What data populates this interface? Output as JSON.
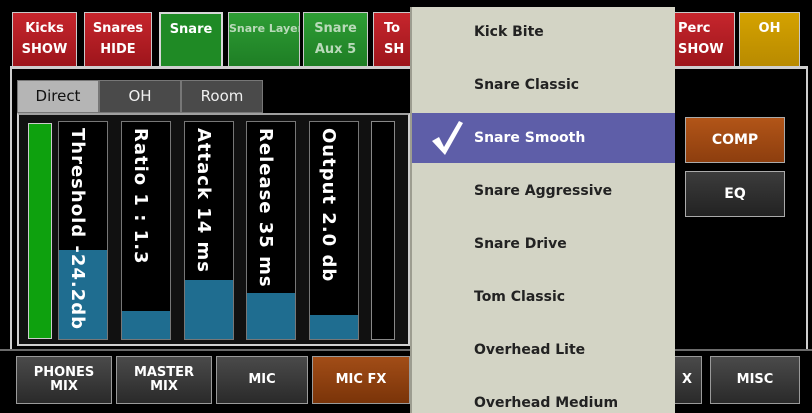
{
  "top_tabs": [
    {
      "line1": "Kicks",
      "line2": "SHOW"
    },
    {
      "line1": "Snares",
      "line2": "HIDE"
    },
    {
      "line1": "Snare",
      "line2": ""
    },
    {
      "line1": "Snare Layer",
      "line2": ""
    },
    {
      "line1": "Snare",
      "line2": "Aux 5"
    },
    {
      "line1": "To",
      "line2": "SH"
    },
    {
      "line1": "Perc",
      "line2": "SHOW"
    },
    {
      "line1": "OH",
      "line2": ""
    }
  ],
  "sub_tabs": [
    "Direct",
    "OH",
    "Room"
  ],
  "knobs": [
    {
      "label": "Threshold -24.2db",
      "level": 0.41
    },
    {
      "label": "Ratio 1 : 1.3",
      "level": 0.13
    },
    {
      "label": "Attack 14 ms",
      "level": 0.27
    },
    {
      "label": "Release 35 ms",
      "level": 0.21
    },
    {
      "label": "Output 2.0 db",
      "level": 0.11
    }
  ],
  "side_buttons": {
    "comp": "COMP",
    "eq": "EQ"
  },
  "bottom_buttons": [
    {
      "line1": "PHONES",
      "line2": "MIX"
    },
    {
      "line1": "MASTER",
      "line2": "MIX"
    },
    {
      "line1": "MIC",
      "line2": ""
    },
    {
      "line1": "MIC FX",
      "line2": ""
    },
    {
      "line1": "X",
      "line2": ""
    },
    {
      "line1": "MISC",
      "line2": ""
    }
  ],
  "dropdown": {
    "items": [
      "Kick Bite",
      "Snare Classic",
      "Snare Smooth",
      "Snare Aggressive",
      "Snare Drive",
      "Tom Classic",
      "Overhead Lite",
      "Overhead Medium"
    ],
    "selected": "Snare Smooth",
    "check_icon": "checkmark-icon"
  },
  "colors": {
    "selection": "#5e5ea8",
    "comp": "#b25518",
    "meter_green": "#0ea10e",
    "knob_fill": "#1f6d90"
  }
}
